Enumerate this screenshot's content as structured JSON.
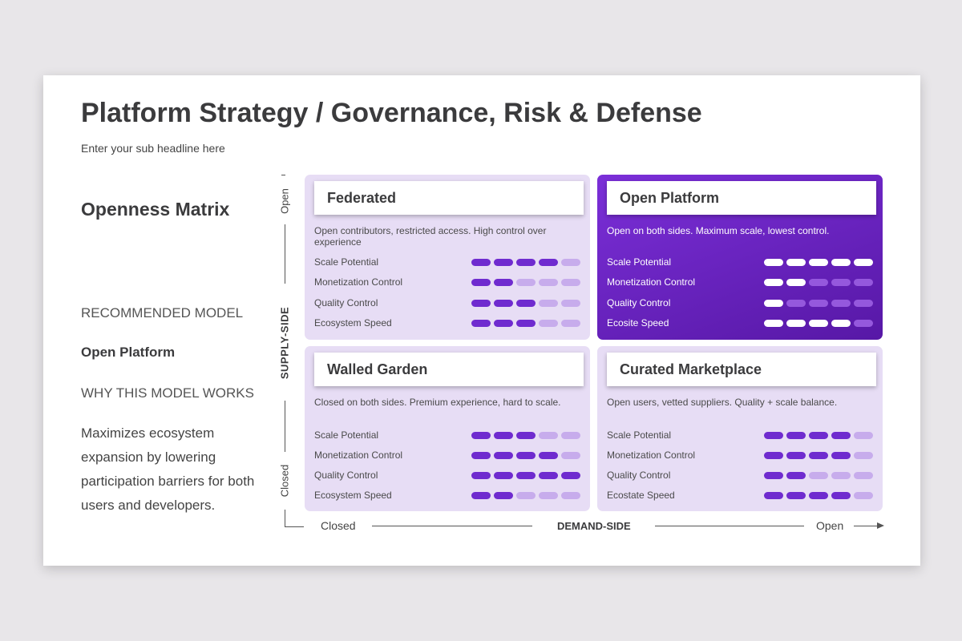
{
  "title": "Platform Strategy / Governance, Risk & Defense",
  "subtitle": "Enter your sub headline here",
  "left": {
    "matrix_title": "Openness Matrix",
    "recommended_label": "RECOMMENDED MODEL",
    "recommended_model": "Open Platform",
    "why_label": "WHY THIS MODEL WORKS",
    "why_text": "Maximizes ecosystem expansion by lowering participation barriers for both users and developers."
  },
  "axes": {
    "y_top": "Open",
    "y_bottom": "Closed",
    "y_title": "SUPPLY-SIDE",
    "x_left": "Closed",
    "x_right": "Open",
    "x_title": "DEMAND-SIDE"
  },
  "colors": {
    "accent": "#6f2bcf",
    "accent_light": "#c7acec",
    "quad_bg": "#e7ddf5",
    "highlight_start": "#7b2fd8",
    "highlight_end": "#5718a6"
  },
  "quadrants": [
    {
      "title": "Federated",
      "desc": "Open contributors, restricted access. High control over experience",
      "highlight": false,
      "metrics": [
        {
          "label": "Scale Potential",
          "value": 4
        },
        {
          "label": "Monetization Control",
          "value": 2
        },
        {
          "label": "Quality Control",
          "value": 3
        },
        {
          "label": "Ecosystem Speed",
          "value": 3
        }
      ]
    },
    {
      "title": "Open Platform",
      "desc": "Open on both sides. Maximum scale, lowest control.",
      "highlight": true,
      "metrics": [
        {
          "label": "Scale Potential",
          "value": 5
        },
        {
          "label": "Monetization Control",
          "value": 2
        },
        {
          "label": "Quality Control",
          "value": 1
        },
        {
          "label": "Ecosite Speed",
          "value": 4
        }
      ]
    },
    {
      "title": "Walled Garden",
      "desc": "Closed on both sides. Premium experience, hard to scale.",
      "highlight": false,
      "metrics": [
        {
          "label": "Scale Potential",
          "value": 3
        },
        {
          "label": "Monetization Control",
          "value": 4
        },
        {
          "label": "Quality Control",
          "value": 5
        },
        {
          "label": "Ecosystem Speed",
          "value": 2
        }
      ]
    },
    {
      "title": "Curated Marketplace",
      "desc": "Open users, vetted suppliers. Quality + scale balance.",
      "highlight": false,
      "metrics": [
        {
          "label": "Scale Potential",
          "value": 4
        },
        {
          "label": "Monetization Control",
          "value": 4
        },
        {
          "label": "Quality Control",
          "value": 2
        },
        {
          "label": "Ecostate Speed",
          "value": 4
        }
      ]
    }
  ],
  "max_rating": 5
}
